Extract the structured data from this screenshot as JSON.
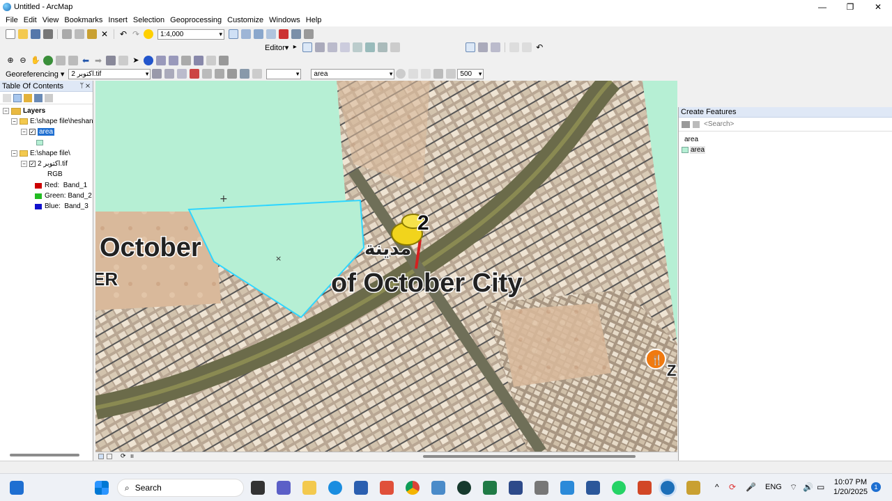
{
  "window": {
    "title": "Untitled - ArcMap",
    "controls": [
      "—",
      "❐",
      "✕"
    ]
  },
  "menu": [
    "File",
    "Edit",
    "View",
    "Bookmarks",
    "Insert",
    "Selection",
    "Geoprocessing",
    "Customize",
    "Windows",
    "Help"
  ],
  "toolbar": {
    "scale": "1:4,000",
    "editor_label": "Editor▾",
    "georef_label": "Georeferencing ▾",
    "georef_layer": "اكتوبر 2.tif",
    "target_layer": "area",
    "count_value": "500"
  },
  "toc": {
    "title": "Table Of Contents",
    "root": "Layers",
    "group1": "E:\\shape file\\heshan",
    "layer1": "area",
    "group2": "E:\\shape file\\",
    "raster": "اكتوبر 2.tif",
    "rgb": "RGB",
    "bands": [
      {
        "label": "Red:",
        "band": "Band_1",
        "color": "#cc0000"
      },
      {
        "label": "Green:",
        "band": "Band_2",
        "color": "#22bb22"
      },
      {
        "label": "Blue:",
        "band": "Band_3",
        "color": "#1111cc"
      }
    ]
  },
  "map": {
    "labels": {
      "october_left": "October",
      "er": "ER",
      "october_city": "of October City",
      "arabic": "مدينة",
      "pin_num": "2",
      "z": "Z"
    },
    "polygon_fill": "#b6efd4",
    "polygon_stroke": "#2fd6ff"
  },
  "create_features": {
    "title": "Create Features",
    "search_placeholder": "<Search>",
    "group": "area",
    "item": "area"
  },
  "taskbar": {
    "search": "Search",
    "lang": "ENG",
    "time": "10:07 PM",
    "date": "1/20/2025",
    "badge": "1"
  }
}
